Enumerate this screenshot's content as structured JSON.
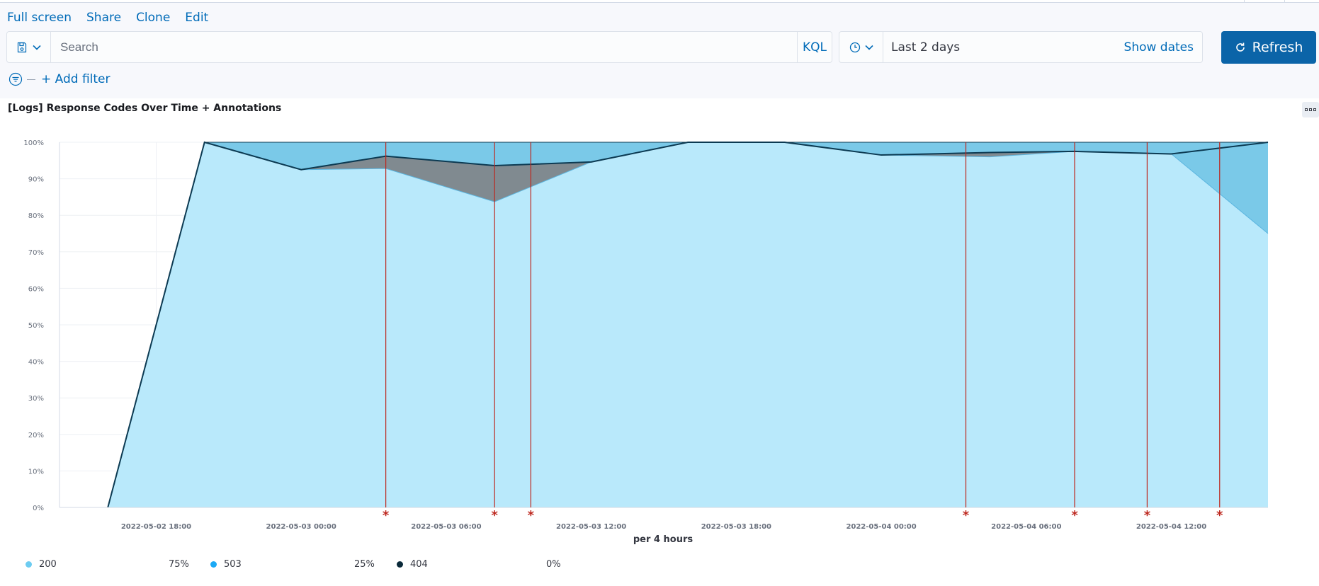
{
  "menu": {
    "full_screen": "Full screen",
    "share": "Share",
    "clone": "Clone",
    "edit": "Edit"
  },
  "query": {
    "placeholder": "Search",
    "language": "KQL",
    "saved_icon": "save-icon",
    "chevron_icon": "chevron-down-icon"
  },
  "time": {
    "range_label": "Last 2 days",
    "show_dates": "Show dates",
    "icon": "clock-icon"
  },
  "refresh": {
    "label": "Refresh",
    "icon": "refresh-icon",
    "color": "#0b64a8"
  },
  "filters": {
    "add_label": "+ Add filter",
    "icon": "filter-icon"
  },
  "panel": {
    "title": "[Logs] Response Codes Over Time + Annotations",
    "menu_icon": "options-icon"
  },
  "chart_data": {
    "type": "area",
    "stacked": "percent",
    "xlabel": "per 4 hours",
    "ylabel": "",
    "ylim": [
      0,
      100
    ],
    "y_ticks": [
      "0%",
      "10%",
      "20%",
      "30%",
      "40%",
      "50%",
      "60%",
      "70%",
      "80%",
      "90%",
      "100%"
    ],
    "x_ticks": [
      "2022-05-02 18:00",
      "2022-05-03 00:00",
      "2022-05-03 06:00",
      "2022-05-03 12:00",
      "2022-05-03 18:00",
      "2022-05-04 00:00",
      "2022-05-04 06:00",
      "2022-05-04 12:00"
    ],
    "x": [
      "2022-05-02 16:00",
      "2022-05-02 20:00",
      "2022-05-03 00:00",
      "2022-05-03 03:30",
      "2022-05-03 08:00",
      "2022-05-03 12:00",
      "2022-05-03 16:00",
      "2022-05-03 20:00",
      "2022-05-04 00:00",
      "2022-05-04 04:30",
      "2022-05-04 08:00",
      "2022-05-04 12:00",
      "2022-05-04 16:00"
    ],
    "series": [
      {
        "name": "200",
        "color": "#b9e9fb",
        "values": [
          0,
          100,
          92.5,
          92.8,
          83.7,
          94.6,
          100,
          100,
          96.5,
          96,
          97.5,
          96.8,
          75
        ]
      },
      {
        "name": "503",
        "color": "#7ac9e8",
        "values": [
          0,
          0,
          0,
          0,
          0,
          0,
          0,
          0,
          0,
          0,
          0,
          0,
          25
        ]
      },
      {
        "name": "404",
        "color": "#0a3449",
        "values": [
          0,
          0,
          0,
          3.4,
          9.9,
          0,
          0,
          0,
          0,
          1.2,
          0,
          0,
          0
        ]
      }
    ],
    "annotations": [
      "2022-05-03 03:30",
      "2022-05-03 08:00",
      "2022-05-03 09:30",
      "2022-05-04 03:30",
      "2022-05-04 08:00",
      "2022-05-04 11:00",
      "2022-05-04 14:00"
    ],
    "annotation_color": "#bd271e",
    "annotation_marker": "*",
    "grid": true,
    "legend_position": "bottom"
  },
  "legend": [
    {
      "name": "200",
      "value": "75%",
      "color": "#6dccf1"
    },
    {
      "name": "503",
      "value": "25%",
      "color": "#1ba9f5"
    },
    {
      "name": "404",
      "value": "0%",
      "color": "#0a2a3a"
    }
  ]
}
